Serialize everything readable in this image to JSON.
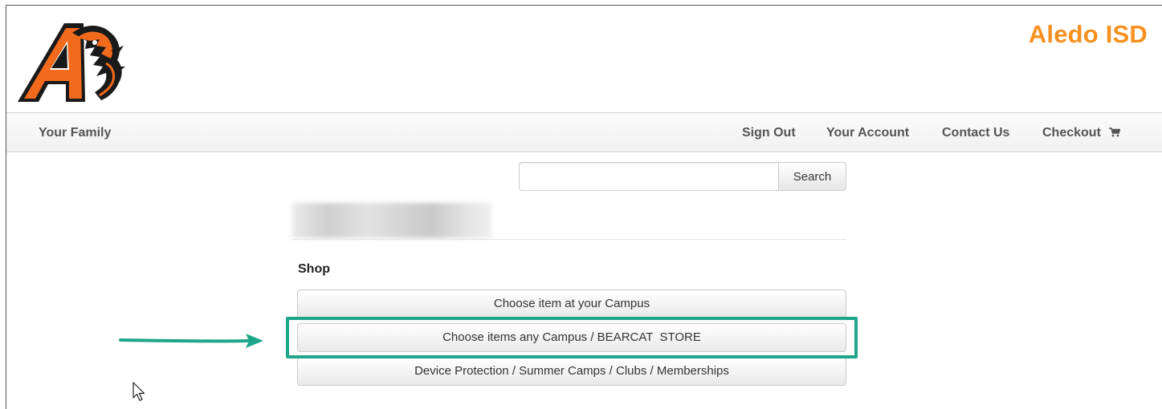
{
  "header": {
    "brand_title": "Aledo ISD",
    "logo_icon": "aledo-bearcat-logo-icon",
    "brand_color": "#f7901e"
  },
  "nav": {
    "your_family": "Your Family",
    "sign_out": "Sign Out",
    "your_account": "Your Account",
    "contact_us": "Contact Us",
    "checkout": "Checkout",
    "checkout_icon": "cart-icon"
  },
  "search": {
    "value": "",
    "placeholder": "",
    "button_label": "Search"
  },
  "shop": {
    "heading": "Shop",
    "buttons": [
      {
        "label": "Choose item at your Campus"
      },
      {
        "label": "Choose items any Campus / BEARCAT  STORE"
      },
      {
        "label": "Device Protection / Summer Camps / Clubs / Memberships"
      }
    ]
  },
  "annotations": {
    "highlight_color": "#1fa68a",
    "arrow_icon": "arrow-right-icon",
    "cursor_icon": "mouse-pointer-icon"
  }
}
